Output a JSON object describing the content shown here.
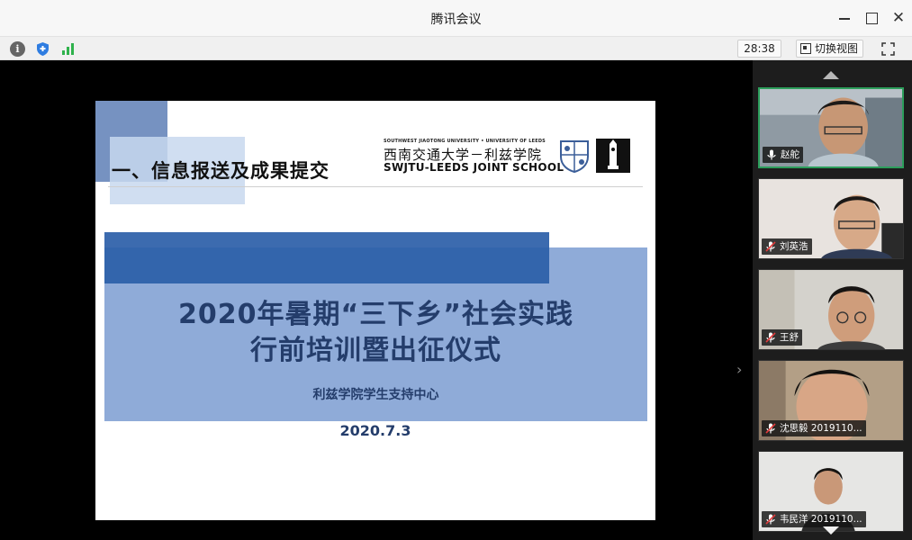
{
  "window": {
    "title": "腾讯会议"
  },
  "toolbar": {
    "timer": "28:38",
    "switch_view_label": "切换视图"
  },
  "slide": {
    "section_title": "一、信息报送及成果提交",
    "university_en": "SOUTHWEST JIAOTONG UNIVERSITY • UNIVERSITY OF LEEDS",
    "university_cn": "西南交通大学－利兹学院",
    "school_name": "SWJTU-LEEDS JOINT SCHOOL",
    "title_line1": "2020年暑期“三下乡”社会实践",
    "title_line2": "行前培训暨出征仪式",
    "organizer": "利兹学院学生支持中心",
    "date": "2020.7.3"
  },
  "participants": [
    {
      "name": "赵舵",
      "mic": "on",
      "active": true
    },
    {
      "name": "刘英浩",
      "mic": "muted",
      "active": false
    },
    {
      "name": "王舒",
      "mic": "muted",
      "active": false
    },
    {
      "name": "沈思毅 2019110...",
      "mic": "muted",
      "active": false
    },
    {
      "name": "韦民洋 2019110...",
      "mic": "muted",
      "active": false
    }
  ],
  "colors": {
    "active_border": "#2c9e5b",
    "banner_dark": "#2b5ea8",
    "banner_light": "#8fabd8",
    "title_text": "#243d6b"
  }
}
